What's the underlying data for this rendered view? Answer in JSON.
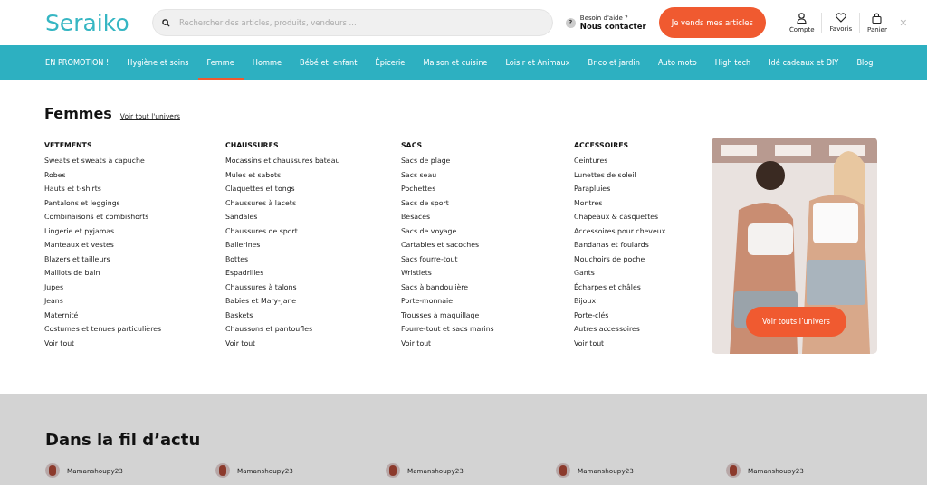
{
  "header": {
    "logo": "Seraiko",
    "search": {
      "placeholder": "Rechercher des articles, produits, vendeurs ..."
    },
    "help": {
      "icon_text": "?",
      "line1": "Besoin d'aide ?",
      "line2": "Nous contacter"
    },
    "sell_button": "Je vends mes articles",
    "actions": [
      {
        "kind": "user",
        "label": "Compte"
      },
      {
        "kind": "heart",
        "label": "Favoris"
      },
      {
        "kind": "bag",
        "label": "Panier"
      }
    ],
    "close": "×"
  },
  "nav": [
    {
      "label": "EN PROMOTION !",
      "selected": false
    },
    {
      "label": "Hygiène et soins",
      "selected": false
    },
    {
      "label": "Femme",
      "selected": true
    },
    {
      "label": "Homme",
      "selected": false
    },
    {
      "label": "Bébé et  enfant",
      "selected": false
    },
    {
      "label": "Épicerie",
      "selected": false
    },
    {
      "label": "Maison et cuisine",
      "selected": false
    },
    {
      "label": "Loisir et Animaux",
      "selected": false
    },
    {
      "label": "Brico et jardin",
      "selected": false
    },
    {
      "label": "Auto moto",
      "selected": false
    },
    {
      "label": "High tech",
      "selected": false
    },
    {
      "label": "Idé cadeaux et DIY",
      "selected": false
    },
    {
      "label": "Blog",
      "selected": false
    }
  ],
  "menu": {
    "title": "Femmes",
    "all_link": "Voir tout l'univers",
    "columns": [
      {
        "heading": "VETEMENTS",
        "items": [
          "Sweats et sweats à capuche",
          "Robes",
          "Hauts et t-shirts",
          "Pantalons et leggings",
          "Combinaisons et combishorts",
          "Lingerie et pyjamas",
          "Manteaux et vestes",
          "Blazers et tailleurs",
          "Maillots de bain",
          "Jupes",
          "Jeans",
          "Maternité",
          "Costumes et tenues particulières"
        ],
        "more": "Voir tout"
      },
      {
        "heading": "CHAUSSURES",
        "items": [
          "Mocassins et chaussures bateau",
          "Mules et sabots",
          "Claquettes et tongs",
          "Chaussures à lacets",
          "Sandales",
          "Chaussures de sport",
          "Ballerines",
          "Bottes",
          "Espadrilles",
          "Chaussures à talons",
          "Babies et Mary-Jane",
          "Baskets",
          "Chaussons et pantoufles"
        ],
        "more": "Voir tout"
      },
      {
        "heading": "SACS",
        "items": [
          "Sacs de plage",
          "Sacs seau",
          "Pochettes",
          "Sacs de sport",
          "Besaces",
          "Sacs de voyage",
          "Cartables et sacoches",
          "Sacs fourre-tout",
          "Wristlets",
          "Sacs à bandoulière",
          "Porte-monnaie",
          "Trousses à maquillage",
          "Fourre-tout et sacs marins"
        ],
        "more": "Voir tout"
      },
      {
        "heading": "ACCESSOIRES",
        "items": [
          "Ceintures",
          "Lunettes de soleil",
          "Parapluies",
          "Montres",
          "Chapeaux & casquettes",
          "Accessoires pour cheveux",
          "Bandanas et foulards",
          "Mouchoirs de poche",
          "Gants",
          "Écharpes et châles",
          "Bijoux",
          "Porte-clés",
          "Autres accessoires"
        ],
        "more": "Voir tout"
      }
    ],
    "promo": {
      "kind": "picture",
      "button": "Voir touts l’univers"
    }
  },
  "feed": {
    "title": "Dans la fil d’actu",
    "posts": [
      {
        "user": "Mamanshoupy23"
      },
      {
        "user": "Mamanshoupy23"
      },
      {
        "user": "Mamanshoupy23"
      },
      {
        "user": "Mamanshoupy23"
      },
      {
        "user": "Mamanshoupy23"
      }
    ]
  }
}
